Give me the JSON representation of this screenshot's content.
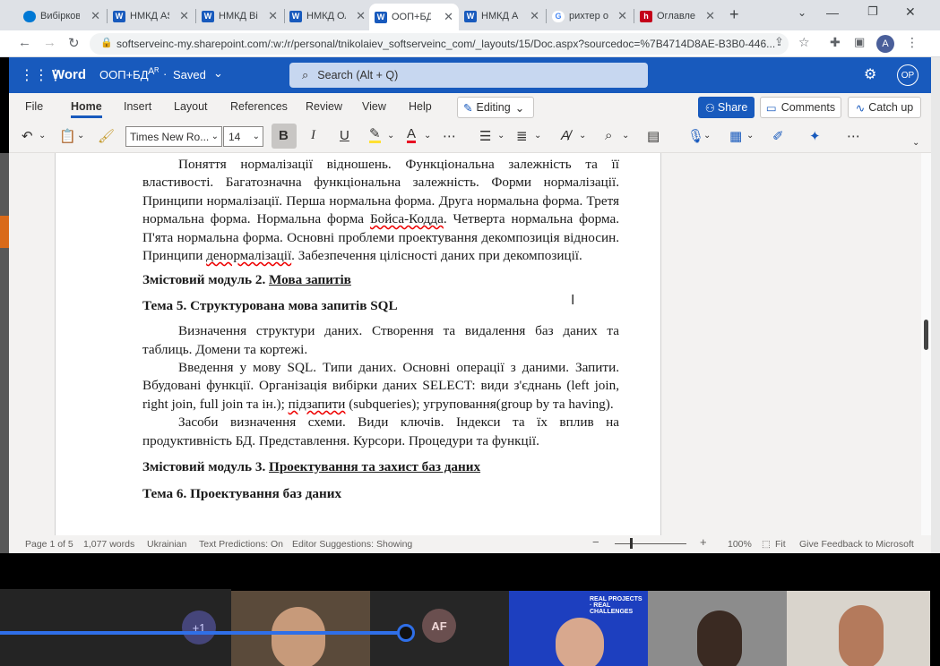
{
  "browser": {
    "tabs": [
      {
        "title": "Вибірков",
        "icon": "onedrive-icon",
        "color": "#0078d4"
      },
      {
        "title": "НМКД АS",
        "icon": "word-icon",
        "color": "#185abd"
      },
      {
        "title": "НМКД Ві",
        "icon": "word-icon",
        "color": "#185abd"
      },
      {
        "title": "НМКД Ол",
        "icon": "word-icon",
        "color": "#185abd"
      },
      {
        "title": "ООП+БД",
        "icon": "word-icon",
        "color": "#185abd"
      },
      {
        "title": "НМКД А",
        "icon": "word-icon",
        "color": "#185abd"
      },
      {
        "title": "рихтер о",
        "icon": "google-icon",
        "color": "#4285f4"
      },
      {
        "title": "Оглавле",
        "icon": "hh-icon",
        "color": "#c4001a"
      }
    ],
    "url": "softserveinc-my.sharepoint.com/:w:/r/personal/tnikolaiev_softserveinc_com/_layouts/15/Doc.aspx?sourcedoc=%7B4714D8AE-B3B0-446...",
    "profile_initial": "A"
  },
  "word": {
    "app_name": "Word",
    "doc_title": "ООП+БД",
    "save_status": "Saved",
    "search_placeholder": "Search (Alt + Q)",
    "user_initials": "OP",
    "ribbon_tabs": [
      "File",
      "Home",
      "Insert",
      "Layout",
      "References",
      "Review",
      "View",
      "Help"
    ],
    "active_tab": "Home",
    "editing_label": "Editing",
    "share_label": "Share",
    "comments_label": "Comments",
    "catchup_label": "Catch up",
    "font_name": "Times New Ro...",
    "font_size": "14"
  },
  "document": {
    "p1": "Поняття нормалізації відношень. Функціональна залежність та її властивості. Багатозначна функціональна залежність. Форми нормалізації. Принципи нормалізації. Перша нормальна форма. Друга нормальна форма. Третя нормальна форма. Нормальна форма",
    "p1_err1": "Бойса-Кодда",
    "p1_mid": ". Четверта нормальна форма. П'ята нормальна форма. Основні проблеми проектування декомпозиція відносин. Принципи",
    "p1_err2": "денормалізації",
    "p1_end": ". Забезпечення цілісності даних при декомпозиції.",
    "m2_prefix": "Змістовий модуль 2.",
    "m2_title": "Мова запитів",
    "t5": "Тема 5. Структурована мова запитів SQL",
    "p2": "Визначення структури даних. Створення та видалення баз даних та таблиць. Домени та кортежі.",
    "p3_a": "Введення у мову SQL. Типи даних. Основні операції з даними. Запити. Вбудовані функції. Організація вибірки даних SELECT: види з'єднань (left join, right join, full join та ін.);",
    "p3_err": "підзапити",
    "p3_b": "(subqueries); угруповання(group by та having).",
    "p4": "Засоби визначення схеми. Види ключів. Індекси та їх вплив на продуктивність БД. Представлення. Курсори. Процедури та функції.",
    "m3_prefix": "Змістовий модуль 3.",
    "m3_title": "Проектування та захист баз даних",
    "t6": "Тема 6. Проектування баз даних"
  },
  "status": {
    "page": "Page 1 of 5",
    "words": "1,077 words",
    "language": "Ukrainian",
    "predictions": "Text Predictions: On",
    "editor": "Editor Suggestions: Showing",
    "zoom": "100%",
    "fit": "Fit",
    "feedback": "Give Feedback to Microsoft"
  },
  "meeting": {
    "extra_count": "+1",
    "participant_initials": "AF",
    "banner_text": "REAL PROJECTS · REAL CHALLENGES"
  }
}
